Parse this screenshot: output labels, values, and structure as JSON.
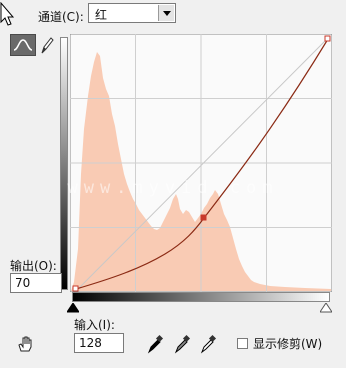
{
  "channel": {
    "label": "通道(C):",
    "value": "红"
  },
  "curve": {
    "output_label": "输出(O):",
    "output_value": "70",
    "input_label": "输入(I):",
    "input_value": "128"
  },
  "options": {
    "show_clipping_label": "显示修剪(W)"
  },
  "watermark": "www.myvid.com",
  "colors": {
    "histogram": "#f9cbb4",
    "curve": "#8b2a14",
    "point": "#c8392b",
    "grid_bg": "#fafafa"
  },
  "icons": [
    "cursor-arrow-icon",
    "curve-tool-icon",
    "pencil-icon",
    "hand-icon",
    "black-eyedropper-icon",
    "gray-eyedropper-icon",
    "white-eyedropper-icon"
  ]
}
